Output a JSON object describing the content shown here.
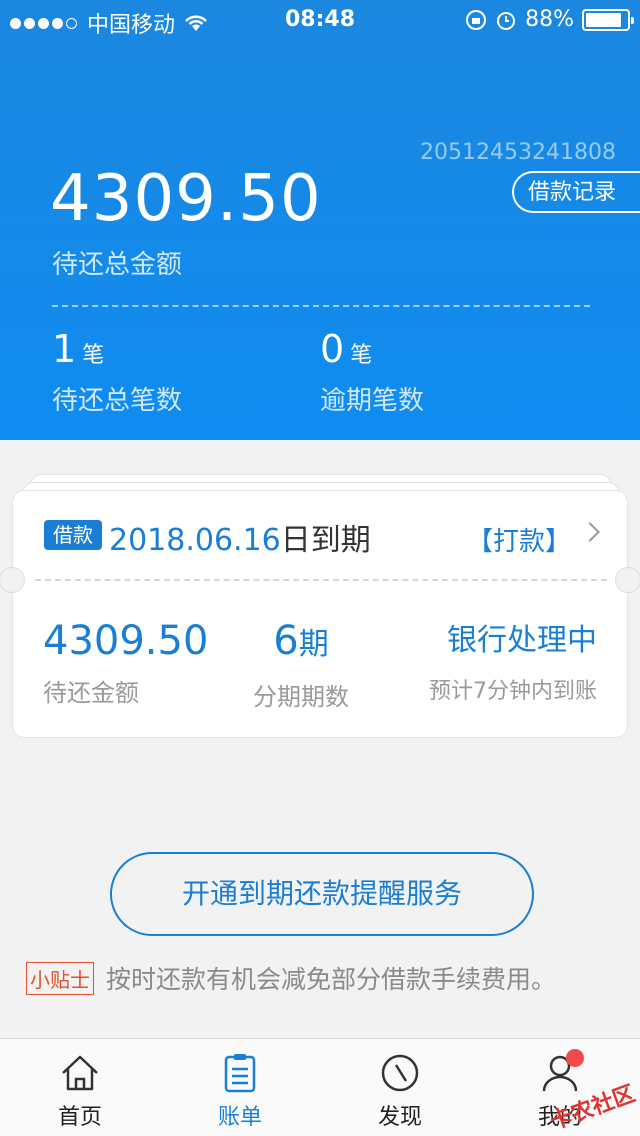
{
  "status_bar": {
    "carrier": "中国移动",
    "time": "08:48",
    "battery": "88%",
    "battery_level": 0.88
  },
  "summary": {
    "loan_id": "20512453241808",
    "records_button": "借款记录",
    "total_amount": "4309.50",
    "total_label": "待还总金额",
    "pending_count": "1",
    "pending_unit": "笔",
    "pending_label": "待还总笔数",
    "overdue_count": "0",
    "overdue_unit": "笔",
    "overdue_label": "逾期笔数"
  },
  "card": {
    "tag": "借款",
    "due_date": "2018.06.16",
    "due_suffix": "日到期",
    "status_link": "【打款】",
    "amount": "4309.50",
    "amount_label": "待还金额",
    "installments": "6",
    "installments_unit": "期",
    "installments_label": "分期期数",
    "bank_status": "银行处理中",
    "bank_eta": "预计7分钟内到账"
  },
  "remind_button": "开通到期还款提醒服务",
  "tip": {
    "badge": "小贴士",
    "text": "按时还款有机会减免部分借款手续费用。"
  },
  "tabs": [
    {
      "label": "首页",
      "icon": "home-icon"
    },
    {
      "label": "账单",
      "icon": "bill-icon",
      "active": true
    },
    {
      "label": "发现",
      "icon": "compass-icon"
    },
    {
      "label": "我的",
      "icon": "user-icon"
    }
  ],
  "watermark": "卡农社区",
  "colors": {
    "primary": "#1a7fd4",
    "tip": "#e5502e",
    "badge": "#f04b4b"
  }
}
